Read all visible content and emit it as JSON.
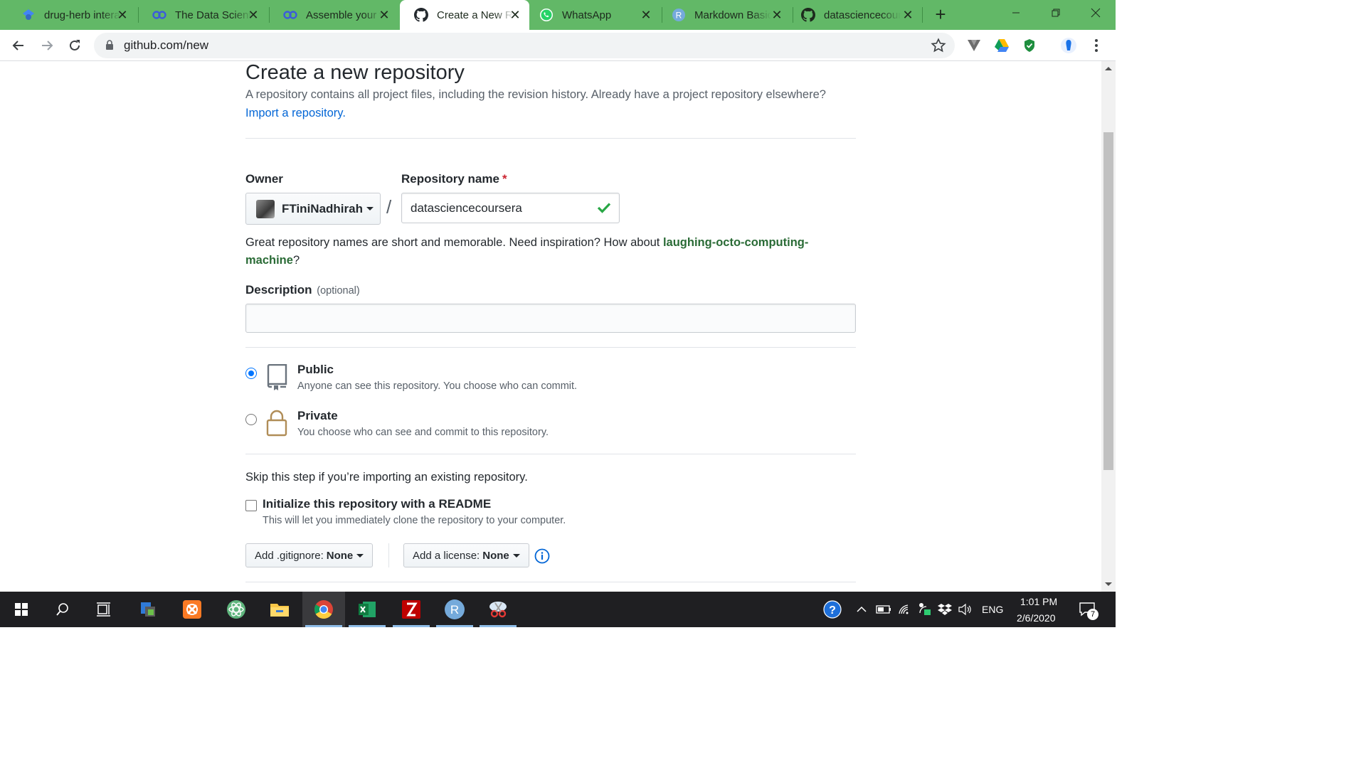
{
  "browser": {
    "tabs": [
      {
        "title": "drug-herb intera",
        "icon": "google-scholar-icon",
        "active": false
      },
      {
        "title": "The Data Scienti",
        "icon": "coursera-icon",
        "active": false
      },
      {
        "title": "Assemble your t",
        "icon": "coursera-icon",
        "active": false
      },
      {
        "title": "Create a New Re",
        "icon": "github-icon",
        "active": true
      },
      {
        "title": "WhatsApp",
        "icon": "whatsapp-icon",
        "active": false
      },
      {
        "title": "Markdown Basic",
        "icon": "rstudio-icon",
        "active": false
      },
      {
        "title": "datasciencecour",
        "icon": "github-icon",
        "active": false
      }
    ],
    "url": "github.com/new",
    "accent_color": "#62b867"
  },
  "page": {
    "title": "Create a new repository",
    "lede": "A repository contains all project files, including the revision history. Already have a project repository elsewhere?",
    "import_link": "Import a repository.",
    "owner_label": "Owner",
    "owner_value": "FTiniNadhirah",
    "repo_label": "Repository name",
    "required_mark": "*",
    "separator": "/",
    "repo_value": "datasciencecoursera",
    "hint_prefix": "Great repository names are short and memorable. Need inspiration? How about ",
    "hint_suggestion": "laughing-octo-computing-machine",
    "hint_suffix": "?",
    "description_label": "Description",
    "description_optional": "(optional)",
    "description_value": "",
    "visibility": [
      {
        "title": "Public",
        "subtitle": "Anyone can see this repository. You choose who can commit.",
        "checked": true,
        "icon": "repo-icon"
      },
      {
        "title": "Private",
        "subtitle": "You choose who can see and commit to this repository.",
        "checked": false,
        "icon": "lock-icon"
      }
    ],
    "skip_text": "Skip this step if you’re importing an existing repository.",
    "readme_title": "Initialize this repository with a README",
    "readme_subtitle": "This will let you immediately clone the repository to your computer.",
    "readme_checked": false,
    "gitignore_label": "Add .gitignore:",
    "gitignore_value": "None",
    "license_label": "Add a license:",
    "license_value": "None"
  },
  "taskbar": {
    "time": "1:01 PM",
    "date": "2/6/2020",
    "language": "ENG",
    "notification_count": "7"
  }
}
